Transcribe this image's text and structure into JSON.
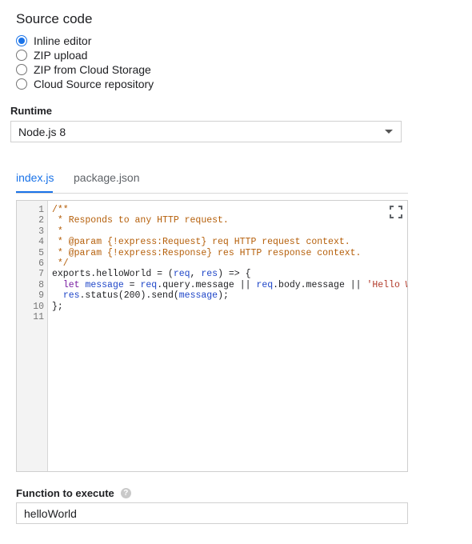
{
  "source_code": {
    "title": "Source code",
    "options": [
      {
        "label": "Inline editor",
        "selected": true
      },
      {
        "label": "ZIP upload",
        "selected": false
      },
      {
        "label": "ZIP from Cloud Storage",
        "selected": false
      },
      {
        "label": "Cloud Source repository",
        "selected": false
      }
    ]
  },
  "runtime": {
    "label": "Runtime",
    "value": "Node.js 8"
  },
  "tabs": [
    {
      "label": "index.js",
      "active": true
    },
    {
      "label": "package.json",
      "active": false
    }
  ],
  "editor": {
    "line_numbers": [
      "1",
      "2",
      "3",
      "4",
      "5",
      "6",
      "7",
      "8",
      "9",
      "10",
      "11"
    ],
    "lines": [
      [
        [
          "c",
          "/**"
        ]
      ],
      [
        [
          "c",
          " * Responds to any HTTP request."
        ]
      ],
      [
        [
          "c",
          " *"
        ]
      ],
      [
        [
          "c",
          " * @param {!express:Request} req HTTP request context."
        ]
      ],
      [
        [
          "c",
          " * @param {!express:Response} res HTTP response context."
        ]
      ],
      [
        [
          "c",
          " */"
        ]
      ],
      [
        [
          "p",
          "exports.helloWorld = ("
        ],
        [
          "v",
          "req"
        ],
        [
          "p",
          ", "
        ],
        [
          "v",
          "res"
        ],
        [
          "p",
          ") => {"
        ]
      ],
      [
        [
          "p",
          "  "
        ],
        [
          "k",
          "let"
        ],
        [
          "p",
          " "
        ],
        [
          "v",
          "message"
        ],
        [
          "p",
          " = "
        ],
        [
          "v",
          "req"
        ],
        [
          "p",
          ".query.message || "
        ],
        [
          "v",
          "req"
        ],
        [
          "p",
          ".body.message || "
        ],
        [
          "s",
          "'Hello World!'"
        ],
        [
          "p",
          ";"
        ]
      ],
      [
        [
          "p",
          "  "
        ],
        [
          "v",
          "res"
        ],
        [
          "p",
          ".status(200).send("
        ],
        [
          "v",
          "message"
        ],
        [
          "p",
          ");"
        ]
      ],
      [
        [
          "p",
          "};"
        ]
      ],
      []
    ],
    "fullscreen_icon": "fullscreen-icon"
  },
  "function_to_execute": {
    "label": "Function to execute",
    "help_icon": "help-icon",
    "help_glyph": "?",
    "value": "helloWorld"
  },
  "colors": {
    "accent": "#1a73e8",
    "comment": "#b55f0a",
    "keyword": "#7a1fa2",
    "variable": "#1f46c8",
    "string": "#b23a2a"
  }
}
